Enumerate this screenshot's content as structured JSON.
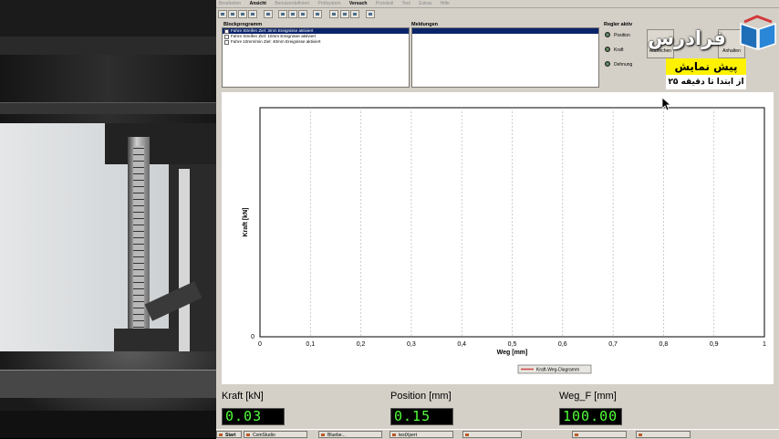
{
  "menu": {
    "items": [
      "Bearbeiten",
      "Ansicht",
      "Benutzerdefiniert",
      "Prüfsystem",
      "Versuch",
      "Protokoll",
      "Tool",
      "Extras",
      "Hilfe"
    ],
    "active_index": 4
  },
  "blockprogramm": {
    "title": "Blockprogramm",
    "rows": [
      "Fahre Streifen Ziel: 3mm Ereignisse aktiviert",
      "Fahre Streifen Ziel: 10mm Ereignisse aktiviert",
      "Fahre 10mm/min Ziel: 40mm Ereignisse aktiviert"
    ],
    "selected_index": 0
  },
  "meldungen": {
    "title": "Meldungen"
  },
  "regler": {
    "title": "Regler aktiv",
    "options": [
      "Position",
      "Kraft",
      "Dehnung"
    ]
  },
  "buttons": {
    "abbrechen": "Abbrechen",
    "anhalten": "Anhalten"
  },
  "chart_data": {
    "type": "line",
    "xlabel": "Weg [mm]",
    "ylabel": "Kraft [kN]",
    "xlim": [
      0,
      1
    ],
    "x_ticks": [
      "0",
      "0,1",
      "0,2",
      "0,3",
      "0,4",
      "0,5",
      "0,6",
      "0,7",
      "0,8",
      "0,9",
      "1"
    ],
    "y_ticks": [
      "0"
    ],
    "grid": "vertical",
    "legend": "Kraft-Weg-Diagramm",
    "legend_position": "bottom",
    "series": [
      {
        "name": "Kraft-Weg-Diagramm",
        "x": [],
        "y": [],
        "color": "#cc4444"
      }
    ]
  },
  "readouts": [
    {
      "label": "Kraft [kN]",
      "value": "0.03"
    },
    {
      "label": "Position [mm]",
      "value": "0.15"
    },
    {
      "label": "Weg_F [mm]",
      "value": "100.00"
    }
  ],
  "taskbar": {
    "items": [
      "Start",
      "ComStudio",
      "Bluebe...",
      "testXpert",
      "",
      "",
      ""
    ]
  },
  "watermark": {
    "brand": "فرادرس",
    "line1": "پیش نمایش",
    "line2": "از ابتدا تا دقیقه ۲۵"
  },
  "colors": {
    "readout_text": "#52ff3a",
    "selection": "#0a246a",
    "watermark_highlight": "#fff200"
  }
}
